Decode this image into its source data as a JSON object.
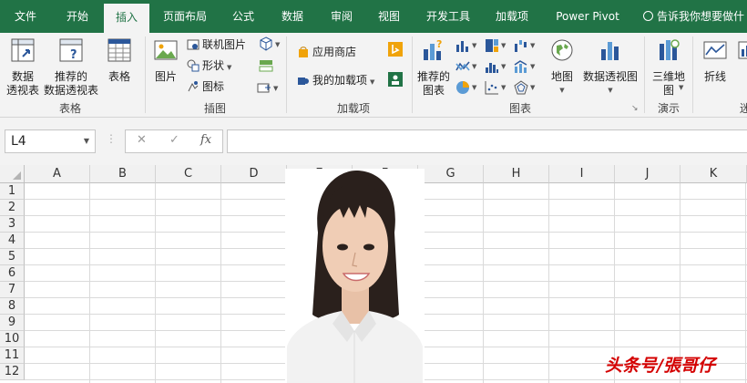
{
  "tabs": [
    {
      "label": "文件"
    },
    {
      "label": "开始"
    },
    {
      "label": "插入",
      "active": true
    },
    {
      "label": "页面布局"
    },
    {
      "label": "公式"
    },
    {
      "label": "数据"
    },
    {
      "label": "审阅"
    },
    {
      "label": "视图"
    },
    {
      "label": "开发工具"
    },
    {
      "label": "加载项"
    },
    {
      "label": "Power Pivot"
    }
  ],
  "tell_me": "告诉我你想要做什",
  "ribbon": {
    "tables_group": {
      "label": "表格",
      "pivot": "数据\n透视表",
      "recommended_pivot": "推荐的\n数据透视表",
      "table": "表格"
    },
    "illustrations_group": {
      "label": "插图",
      "picture": "图片",
      "online_picture": "联机图片",
      "shapes": "形状",
      "icons": "图标"
    },
    "addins_group": {
      "label": "加载项",
      "store": "应用商店",
      "my_addins": "我的加载项"
    },
    "charts_group": {
      "label": "图表",
      "recommended_charts": "推荐的\n图表",
      "map": "地图",
      "pivot_chart": "数据透视图"
    },
    "tours_group": {
      "label": "演示",
      "map3d": "三维地\n图"
    },
    "sparklines_group": {
      "label": "迷",
      "line": "折线"
    }
  },
  "formula_bar": {
    "name_box": "L4",
    "cancel": "✕",
    "enter": "✓",
    "fx": "fx",
    "formula": ""
  },
  "columns": [
    "A",
    "B",
    "C",
    "D",
    "E",
    "F",
    "G",
    "H",
    "I",
    "J",
    "K"
  ],
  "rows": [
    "1",
    "2",
    "3",
    "4",
    "5",
    "6",
    "7",
    "8",
    "9",
    "10",
    "11",
    "12"
  ],
  "watermark": "头条号/張哥仔",
  "colors": {
    "excel_green": "#217346",
    "ribbon_bg": "#f3f3f3",
    "watermark": "#d40000"
  }
}
